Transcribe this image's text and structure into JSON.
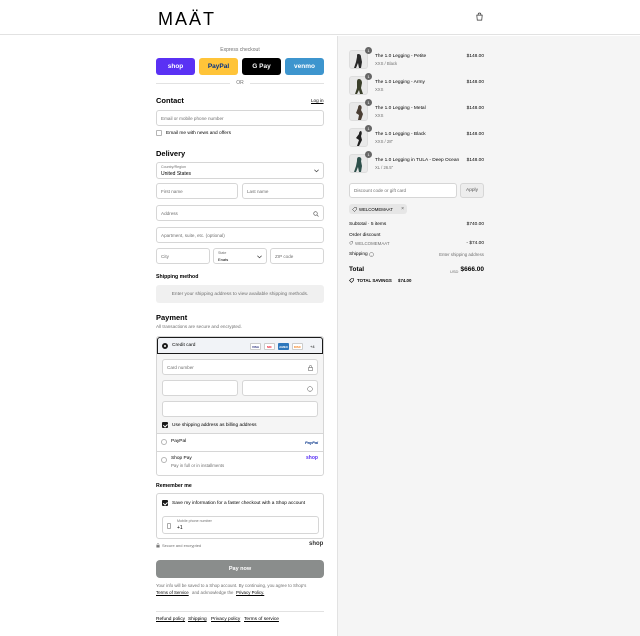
{
  "brand": {
    "logo_text": "MAÄT"
  },
  "express": {
    "label": "Express checkout",
    "buttons": [
      {
        "label": "shop",
        "bg": "#5a31f4",
        "color": "#ffffff"
      },
      {
        "label": "PayPal",
        "bg": "#ffc439",
        "color": "#003087"
      },
      {
        "label": "G Pay",
        "bg": "#000000",
        "color": "#ffffff"
      },
      {
        "label": "venmo",
        "bg": "#3d95ce",
        "color": "#ffffff"
      }
    ],
    "or": "OR"
  },
  "contact": {
    "title": "Contact",
    "login": "Log in",
    "email_placeholder": "Email or mobile phone number",
    "newsletter": "Email me with news and offers"
  },
  "delivery": {
    "title": "Delivery",
    "country_label": "Country/Region",
    "country_value": "United States",
    "first_name": "First name",
    "last_name": "Last name",
    "address": "Address",
    "apartment": "Apartment, suite, etc. (optional)",
    "city": "City",
    "state_label": "State",
    "state_value": "Enats",
    "zip": "ZIP code"
  },
  "shipping": {
    "title": "Shipping method",
    "message": "Enter your shipping address to view available shipping methods."
  },
  "payment": {
    "title": "Payment",
    "subtitle": "All transactions are secure and encrypted.",
    "credit_card": "Credit card",
    "card_more": "+4",
    "card_number": "Card number",
    "billing": "Use shipping address as billing address",
    "paypal": "PayPal",
    "shop_pay": "Shop Pay",
    "shop_pay_sub": "Pay in full or in installments",
    "card_icons": [
      "VISA",
      "MC",
      "AMEX",
      "DISC"
    ]
  },
  "remember": {
    "title": "Remember me",
    "save": "Save my information for a faster checkout with a Shop account",
    "phone_label": "Mobile phone number",
    "phone_value": "+1",
    "secure": "Secure and encrypted",
    "shop": "shop"
  },
  "pay_now": "Pay now",
  "legal": {
    "line1": "Your info will be saved to a Shop account. By continuing, you agree to Shop's",
    "terms": "Terms of Service",
    "and": "and acknowledge the",
    "privacy": "Privacy Policy."
  },
  "footer_links": [
    "Refund policy",
    "Shipping",
    "Privacy policy",
    "Terms of service"
  ],
  "cart": {
    "items": [
      {
        "name": "The 1.0 Legging - Petite",
        "variant": "XXS / Black",
        "price": "$148.00",
        "qty": "1"
      },
      {
        "name": "The 1.0 Legging - Army",
        "variant": "XXS",
        "price": "$148.00",
        "qty": "1"
      },
      {
        "name": "The 1.0 Legging - Metal",
        "variant": "XXS",
        "price": "$148.00",
        "qty": "1"
      },
      {
        "name": "The 1.0 Legging - Black",
        "variant": "XXS / 28\"",
        "price": "$148.00",
        "qty": "1"
      },
      {
        "name": "The 1.0 Legging in TULA - Deep Ocean",
        "variant": "XL / 26.5\"",
        "price": "$148.00",
        "qty": "1"
      }
    ],
    "discount_placeholder": "Discount code or gift card",
    "apply": "Apply",
    "code": "WELCOMEMAAT",
    "subtotal_label": "Subtotal · 5 items",
    "subtotal_value": "$740.00",
    "order_discount": "Order discount",
    "discount_code": "WELCOMEMAAT",
    "discount_value": "- $74.00",
    "shipping_label": "Shipping",
    "shipping_value": "Enter shipping address",
    "total_label": "Total",
    "currency": "USD",
    "total_value": "$666.00",
    "savings_label": "TOTAL SAVINGS",
    "savings_value": "$74.00"
  }
}
